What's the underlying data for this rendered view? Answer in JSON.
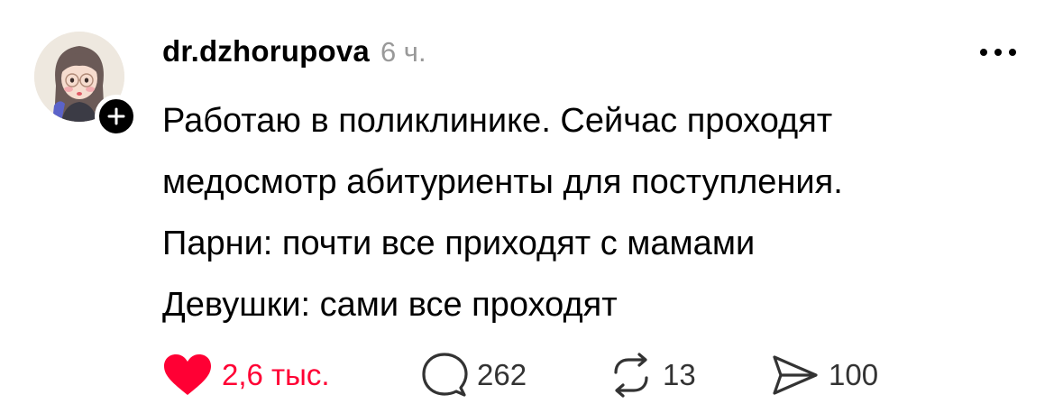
{
  "post": {
    "author": "dr.dzhorupova",
    "time": "6 ч.",
    "lines": [
      "Работаю в поликлинике. Сейчас проходят",
      "медосмотр абитуриенты для поступления.",
      "Парни: почти все приходят с мамами",
      "Девушки: сами все проходят"
    ]
  },
  "actions": {
    "likes": "2,6 тыс.",
    "comments": "262",
    "reposts": "13",
    "shares": "100"
  },
  "icons": {
    "avatar": "avatar-illustration",
    "follow": "plus-icon",
    "more": "more-icon",
    "like": "heart-icon",
    "comment": "comment-icon",
    "repost": "repost-icon",
    "share": "send-icon"
  },
  "colors": {
    "like_active": "#ff0034",
    "muted": "#999999",
    "text": "#000000"
  }
}
